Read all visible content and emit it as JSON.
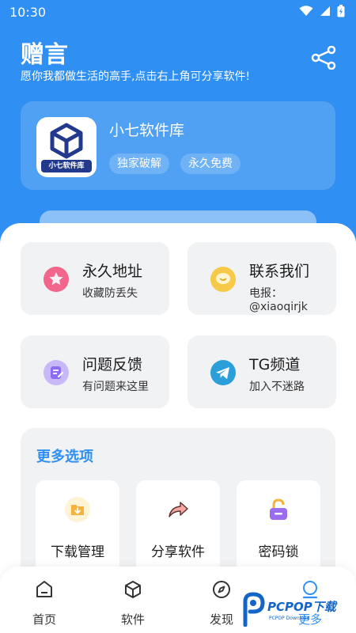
{
  "status_bar": {
    "time": "10:30"
  },
  "header": {
    "title": "赠言",
    "subtitle": "愿你我都做生活的高手,点击右上角可分享软件!"
  },
  "profile": {
    "app_name": "小七软件库",
    "logo_text": "小七软件库",
    "tags": [
      "独家破解",
      "永久免费"
    ]
  },
  "actions": [
    {
      "title": "永久地址",
      "subtitle": "收藏防丢失",
      "icon": "star-icon",
      "color": "#f2668b"
    },
    {
      "title": "联系我们",
      "subtitle": "电报：@xiaoqirjk",
      "icon": "chat-icon",
      "color": "#f7c948"
    },
    {
      "title": "问题反馈",
      "subtitle": "有问题来这里",
      "icon": "feedback-icon",
      "color": "#9b7bf2"
    },
    {
      "title": "TG频道",
      "subtitle": "加入不迷路",
      "icon": "telegram-icon",
      "color": "#2a9fd9"
    }
  ],
  "more": {
    "title": "更多选项",
    "options": [
      {
        "label": "下载管理",
        "icon": "download-folder-icon"
      },
      {
        "label": "分享软件",
        "icon": "share-arrow-icon"
      },
      {
        "label": "密码锁",
        "icon": "lock-icon"
      }
    ]
  },
  "bottom_nav": {
    "items": [
      {
        "label": "首页",
        "icon": "home-icon"
      },
      {
        "label": "软件",
        "icon": "cube-icon"
      },
      {
        "label": "发现",
        "icon": "compass-icon"
      },
      {
        "label": "更多",
        "icon": "more-icon",
        "active": true
      }
    ]
  },
  "watermark": {
    "text": "PCPOP下载",
    "small": "PCPOP Download"
  },
  "colors": {
    "primary": "#2f8ff2",
    "background": "#f2f3f5"
  }
}
